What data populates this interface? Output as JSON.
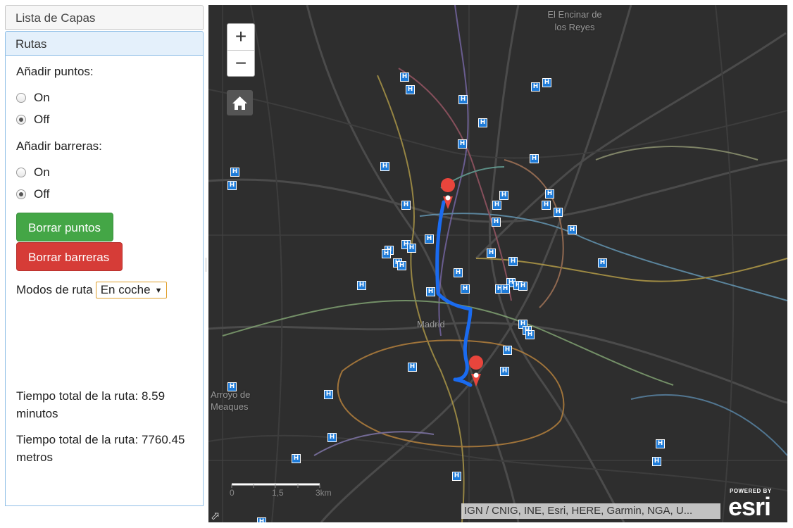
{
  "sidebar": {
    "layers_header": "Lista de Capas",
    "routes_header": "Rutas",
    "add_points_label": "Añadir puntos:",
    "add_points_on": "On",
    "add_points_off": "Off",
    "add_points_selected": "Off",
    "add_barriers_label": "Añadir barreras:",
    "add_barriers_on": "On",
    "add_barriers_off": "Off",
    "add_barriers_selected": "Off",
    "clear_points_button": "Borrar puntos",
    "clear_barriers_button": "Borrar barreras",
    "route_mode_label": "Modos de ruta",
    "route_mode_value": "En coche",
    "total_time_text": "Tiempo total de la ruta: 8.59 minutos",
    "total_distance_text": "Tiempo total de la ruta: 7760.45 metros"
  },
  "map": {
    "zoom_in": "+",
    "zoom_out": "−",
    "city_labels": {
      "encinar": "El Encinar de los Reyes",
      "madrid": "Madrid",
      "arroyo": "Arroyo de Meaques"
    },
    "scale_labels": [
      "0",
      "1,5",
      "3km"
    ],
    "attribution": "IGN / CNIG, INE, Esri, HERE, Garmin, NGA, U...",
    "esri_powered": "POWERED BY",
    "esri_logo": "esri",
    "marker_letter": "H",
    "route_color": "#1a6bf0",
    "pin_color": "#e8453c",
    "hospital_marker_color": "#1e7bd8"
  }
}
